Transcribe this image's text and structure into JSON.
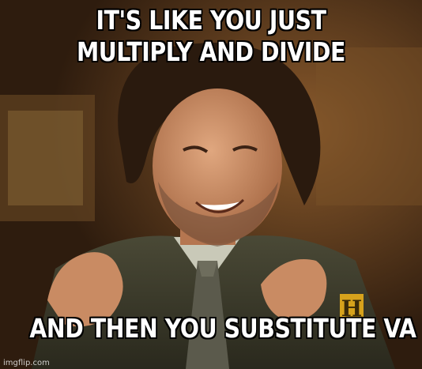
{
  "meme": {
    "top_text_line1": "IT'S LIKE YOU JUST",
    "top_text_line2": "MULTIPLY AND DIVIDE",
    "bottom_text": "AND THEN YOU SUBSTITUTE VA",
    "watermark": "imgflip.com"
  },
  "colors": {
    "caption_fill": "#ffffff",
    "caption_outline": "#000000",
    "background_warm": "#4a2f18",
    "suit": "#3b3a2c",
    "skin": "#c98b63",
    "hair": "#2a1a0e",
    "logo_gold": "#d6a21c"
  }
}
